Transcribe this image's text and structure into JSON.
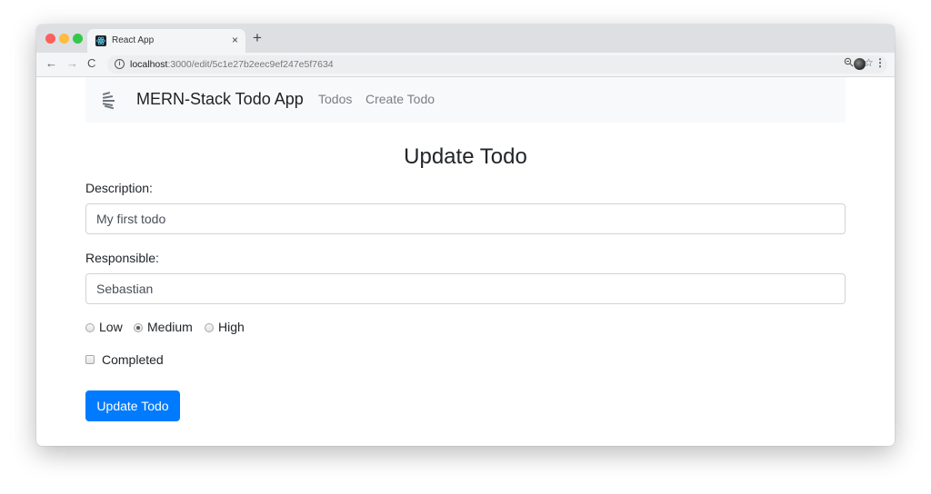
{
  "browser": {
    "tab_title": "React App",
    "tab_close": "×",
    "new_tab": "+",
    "url_host": "localhost",
    "url_path": ":3000/edit/5c1e27b2eec9ef247e5f7634"
  },
  "navbar": {
    "brand": "MERN-Stack Todo App",
    "links": [
      "Todos",
      "Create Todo"
    ]
  },
  "form": {
    "title": "Update Todo",
    "description_label": "Description:",
    "description_value": "My first todo",
    "responsible_label": "Responsible:",
    "responsible_value": "Sebastian",
    "priority_options": [
      "Low",
      "Medium",
      "High"
    ],
    "priority_selected": "Medium",
    "completed_label": "Completed",
    "completed_checked": false,
    "submit_label": "Update Todo"
  },
  "colors": {
    "primary": "#007bff",
    "navbar_bg": "#f8f9fa"
  }
}
